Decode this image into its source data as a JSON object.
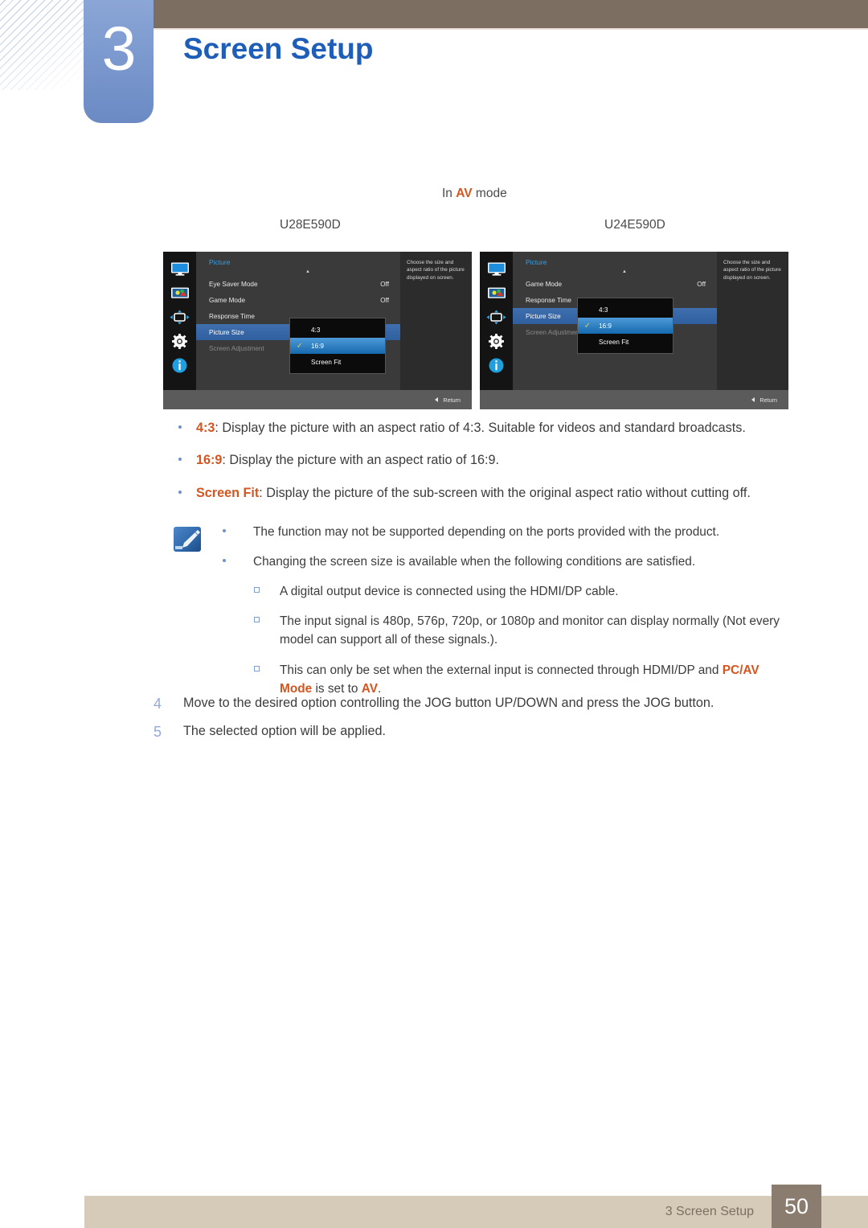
{
  "header": {
    "chapter_number": "3",
    "chapter_title": "Screen Setup"
  },
  "intro": {
    "prefix": "In ",
    "mode": "AV",
    "suffix": " mode"
  },
  "models": {
    "left": "U28E590D",
    "right": "U24E590D"
  },
  "osd": {
    "left": {
      "title": "Picture",
      "caret": "▲",
      "rows": [
        {
          "label": "Eye Saver Mode",
          "value": "Off",
          "state": "normal"
        },
        {
          "label": "Game Mode",
          "value": "Off",
          "state": "normal"
        },
        {
          "label": "Response Time",
          "value": "",
          "state": "normal"
        },
        {
          "label": "Picture Size",
          "value": "",
          "state": "selected"
        },
        {
          "label": "Screen Adjustment",
          "value": "",
          "state": "dim"
        }
      ],
      "popup": [
        {
          "label": "4:3",
          "checked": false
        },
        {
          "label": "16:9",
          "checked": true
        },
        {
          "label": "Screen Fit",
          "checked": false
        }
      ],
      "description": "Choose the size and aspect ratio of the picture displayed on screen.",
      "return_label": "Return"
    },
    "right": {
      "title": "Picture",
      "caret": "▲",
      "rows": [
        {
          "label": "Game Mode",
          "value": "Off",
          "state": "normal"
        },
        {
          "label": "Response Time",
          "value": "",
          "state": "normal"
        },
        {
          "label": "Picture Size",
          "value": "",
          "state": "selected"
        },
        {
          "label": "Screen Adjustment",
          "value": "",
          "state": "dim"
        }
      ],
      "popup": [
        {
          "label": "4:3",
          "checked": false
        },
        {
          "label": "16:9",
          "checked": true
        },
        {
          "label": "Screen Fit",
          "checked": false
        }
      ],
      "description": "Choose the size and aspect ratio of the picture displayed on screen.",
      "return_label": "Return"
    },
    "rail_icons": [
      "display-icon",
      "picture-icon",
      "screen-adjustment-icon",
      "system-gear-icon",
      "information-icon"
    ],
    "check_glyph": "✓"
  },
  "options": [
    {
      "term": "4:3",
      "text": ": Display the picture with an aspect ratio of 4:3. Suitable for videos and standard broadcasts."
    },
    {
      "term": "16:9",
      "text": ": Display the picture with an aspect ratio of 16:9."
    },
    {
      "term": "Screen Fit",
      "text": ": Display the picture of the sub-screen with the original aspect ratio without cutting off."
    }
  ],
  "notes": [
    {
      "level": 1,
      "text": "The function may not be supported depending on the ports provided with the product."
    },
    {
      "level": 1,
      "text": "Changing the screen size is available when the following conditions are satisfied."
    },
    {
      "level": 2,
      "text": "A digital output device is connected using the HDMI/DP cable."
    },
    {
      "level": 2,
      "text": "The input signal is 480p, 576p, 720p, or 1080p and monitor can display normally (Not every model can support all of these signals.)."
    },
    {
      "level": 2,
      "text_pre": "This can only be set when the external input is connected through HDMI/DP and ",
      "term1": "PC/AV Mode",
      "text_mid": " is set to ",
      "term2": "AV",
      "text_post": "."
    }
  ],
  "steps": [
    {
      "num": "4",
      "text": "Move to the desired option controlling the JOG button UP/DOWN and press the JOG button."
    },
    {
      "num": "5",
      "text": "The selected option will be applied."
    }
  ],
  "footer": {
    "text": "3 Screen Setup",
    "page": "50"
  },
  "colors": {
    "accent_orange": "#d4551f",
    "title_blue": "#1e5eb8",
    "header_brown": "#7c6f62",
    "footer_tan": "#d6cbb9",
    "badge_blue": "#7e9bd0",
    "osd_select_blue": "#2f5f9e",
    "osd_popup_blue": "#1569ad",
    "osd_title_cyan": "#3d9fe0",
    "check_yellow": "#ffd83b"
  }
}
